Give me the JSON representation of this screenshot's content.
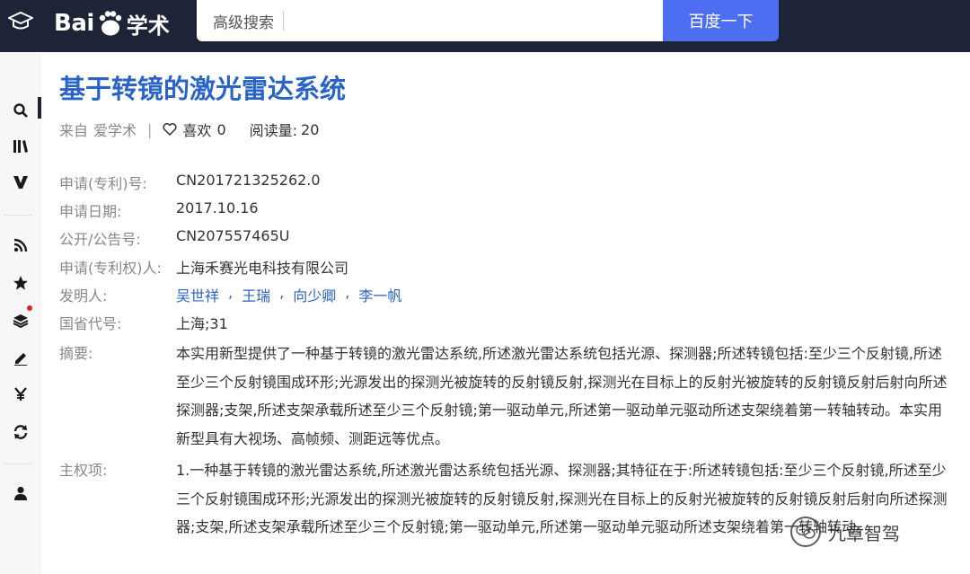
{
  "header": {
    "logo_latin": "Bai",
    "logo_paw": "du",
    "logo_cjk": "学术",
    "search_advanced": "高级搜索",
    "search_value": "",
    "search_button": "百度一下"
  },
  "sidebar": {
    "icons": [
      "graduation-cap-icon",
      "search-icon",
      "library-icon",
      "v-icon",
      "rss-icon",
      "star-icon",
      "layers-icon",
      "pencil-icon",
      "yen-icon",
      "refresh-icon",
      "user-icon"
    ]
  },
  "article": {
    "title": "基于转镜的激光雷达系统",
    "from_label": "来自",
    "from_value": "爱学术",
    "like_label": "喜欢",
    "like_count": "0",
    "read_label": "阅读量:",
    "read_count": "20"
  },
  "fields": {
    "app_no_label": "申请(专利)号:",
    "app_no": "CN201721325262.0",
    "app_date_label": "申请日期:",
    "app_date": "2017.10.16",
    "pub_no_label": "公开/公告号:",
    "pub_no": "CN207557465U",
    "applicant_label": "申请(专利权)人:",
    "applicant": "上海禾赛光电科技有限公司",
    "inventors_label": "发明人:",
    "inventors": [
      "吴世祥",
      "王瑞",
      "向少卿",
      "李一帆"
    ],
    "inventor_sep": ",",
    "region_label": "国省代号:",
    "region": "上海;31",
    "abstract_label": "摘要:",
    "abstract": "本实用新型提供了一种基于转镜的激光雷达系统,所述激光雷达系统包括光源、探测器;所述转镜包括:至少三个反射镜,所述至少三个反射镜围成环形;光源发出的探测光被旋转的反射镜反射,探测光在目标上的反射光被旋转的反射镜反射后射向所述探测器;支架,所述支架承载所述至少三个反射镜;第一驱动单元,所述第一驱动单元驱动所述支架绕着第一转轴转动。本实用新型具有大视场、高帧频、测距远等优点。",
    "claim_label": "主权项:",
    "claim": "1.一种基于转镜的激光雷达系统,所述激光雷达系统包括光源、探测器;其特征在于:所述转镜包括:至少三个反射镜,所述至少三个反射镜围成环形;光源发出的探测光被旋转的反射镜反射,探测光在目标上的反射光被旋转的反射镜反射后射向所述探测器;支架,所述支架承载所述至少三个反射镜;第一驱动单元,所述第一驱动单元驱动所述支架绕着第一转轴转动。"
  },
  "watermark": {
    "text": "九章智驾"
  }
}
